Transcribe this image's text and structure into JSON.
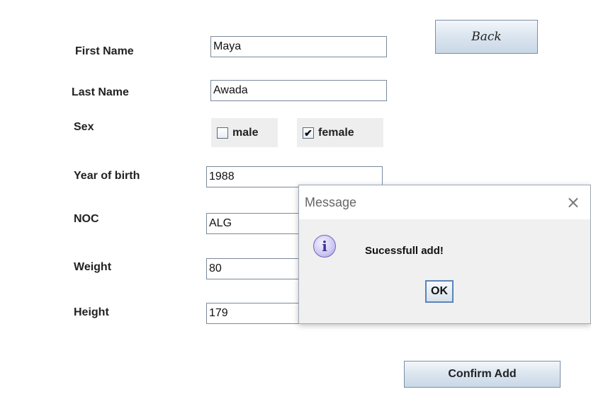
{
  "form": {
    "first_name": {
      "label": "First Name",
      "value": "Maya"
    },
    "last_name": {
      "label": "Last Name",
      "value": "Awada"
    },
    "sex": {
      "label": "Sex",
      "options": [
        {
          "label": "male",
          "checked": false
        },
        {
          "label": "female",
          "checked": true
        }
      ]
    },
    "year_of_birth": {
      "label": "Year of birth",
      "value": "1988"
    },
    "noc": {
      "label": "NOC",
      "value": "ALG"
    },
    "weight": {
      "label": "Weight",
      "value": "80"
    },
    "height": {
      "label": "Height",
      "value": "179"
    },
    "back_label": "Back",
    "confirm_label": "Confirm Add"
  },
  "dialog": {
    "title": "Message",
    "close_glyph": "×",
    "icon": "info-icon",
    "message": "Sucessfull add!",
    "ok_label": "OK"
  },
  "icons": {
    "check": "✔"
  }
}
